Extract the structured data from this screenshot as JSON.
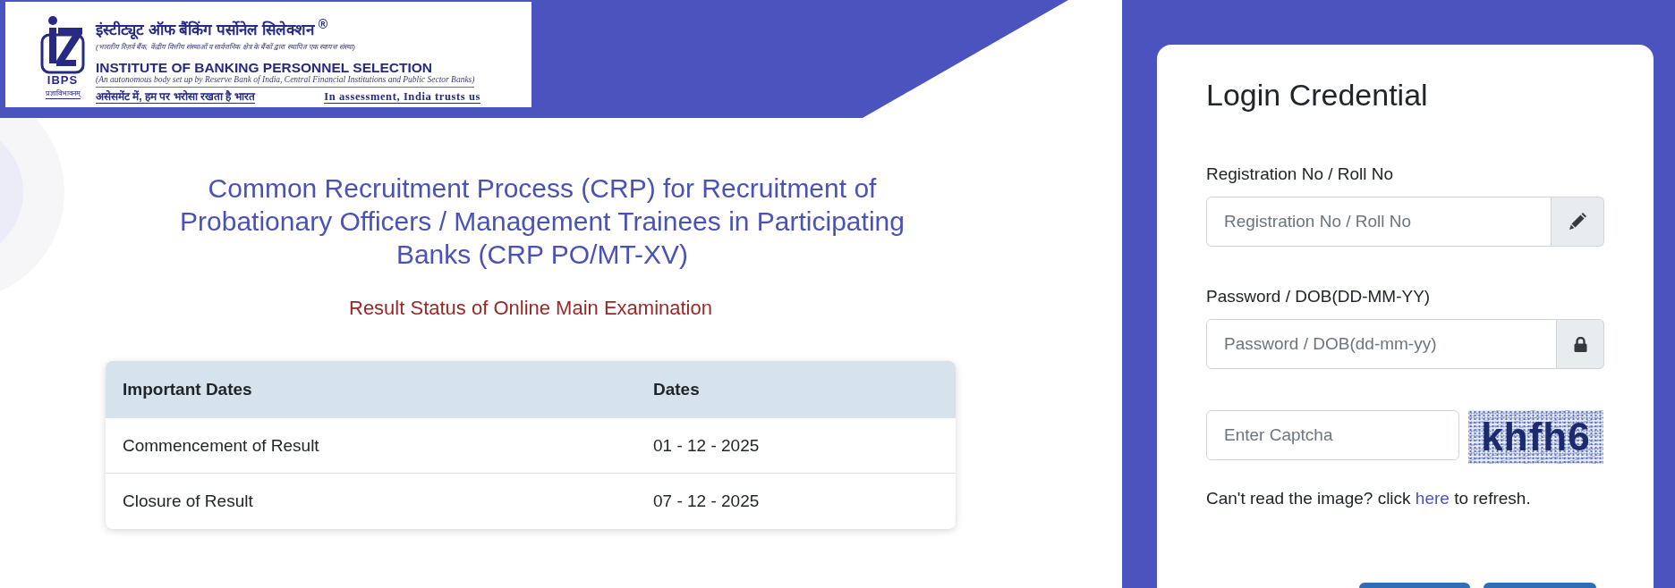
{
  "header": {
    "logo": {
      "hindi_name": "इंस्टीट्यूट ऑफ बैंकिंग पर्सोनेल सिलेक्शन $^{®}$",
      "hindi_description": "(भारतीय रिज़र्व बैंक, केंद्रीय वित्तीय संस्थाओं व सार्वजनिक क्षेत्र के बैंकों द्वारा स्थापित एक स्वायत्त संस्था)",
      "english_name": "INSTITUTE OF BANKING PERSONNEL SELECTION",
      "english_description": "(An autonomous body set up by Reserve Bank of India, Central Financial Institutions and Public Sector Banks)",
      "emblem_label": "IBPS",
      "emblem_motto": "प्रज्ञाविभावनम्",
      "hindi_slogan": "असेसमेंट में, हम पर भरोसा रखता है भारत",
      "english_slogan": "In assessment, India trusts us"
    }
  },
  "main": {
    "title": "Common Recruitment Process (CRP) for Recruitment of Probationary Officers / Management Trainees in Participating Banks (CRP PO/MT-XV)",
    "subtitle": "Result Status of Online Main Examination",
    "table": {
      "columns": [
        "Important Dates",
        "Dates"
      ],
      "rows": [
        [
          "Commencement of Result",
          "01 - 12 - 2025"
        ],
        [
          "Closure of Result",
          "07 - 12 - 2025"
        ]
      ]
    }
  },
  "login": {
    "title": "Login Credential",
    "fields": [
      {
        "kind": "text",
        "label": "Registration No / Roll No",
        "placeholder": "Registration No / Roll No"
      },
      {
        "kind": "password",
        "label": "Password / DOB(DD-MM-YY)",
        "placeholder": "Password / DOB(dd-mm-yy)"
      }
    ],
    "captcha": {
      "placeholder": "Enter Captcha",
      "image_text": "khfh6"
    },
    "refresh_hint": {
      "before": "Can't read the image? click",
      "link": "here",
      "after": "to refresh."
    }
  }
}
